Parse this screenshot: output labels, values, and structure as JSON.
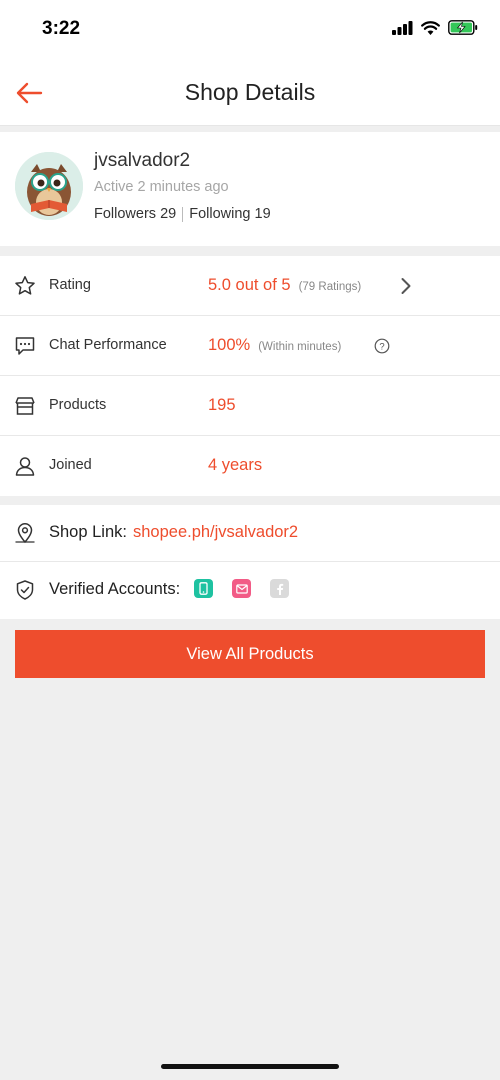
{
  "status_bar": {
    "time": "3:22"
  },
  "header": {
    "title": "Shop Details",
    "back_icon": "arrow-left-icon"
  },
  "shop": {
    "name": "jvsalvador2",
    "active_status": "Active 2 minutes ago",
    "followers_label": "Followers",
    "followers_count": "29",
    "following_label": "Following",
    "following_count": "19"
  },
  "stats": [
    {
      "icon": "star-icon",
      "label": "Rating",
      "value": "5.0 out of 5",
      "note": "(79 Ratings)"
    },
    {
      "icon": "chat-icon",
      "label": "Chat Performance",
      "value": "100%",
      "note": "(Within minutes)"
    },
    {
      "icon": "store-icon",
      "label": "Products",
      "value": "195"
    },
    {
      "icon": "user-icon",
      "label": "Joined",
      "value": "4 years"
    }
  ],
  "shop_link": {
    "label": "Shop Link:",
    "value": "shopee.ph/jvsalvador2"
  },
  "verified": {
    "label": "Verified Accounts:",
    "badges": [
      "phone-verified-icon",
      "email-verified-icon",
      "facebook-unverified-icon"
    ]
  },
  "actions": {
    "view_all_label": "View All Products"
  },
  "colors": {
    "accent": "#ee4d2d",
    "background": "#efefef",
    "phone_badge": "#1ec2a1",
    "email_badge": "#f25b86",
    "facebook_badge": "#dadada"
  }
}
